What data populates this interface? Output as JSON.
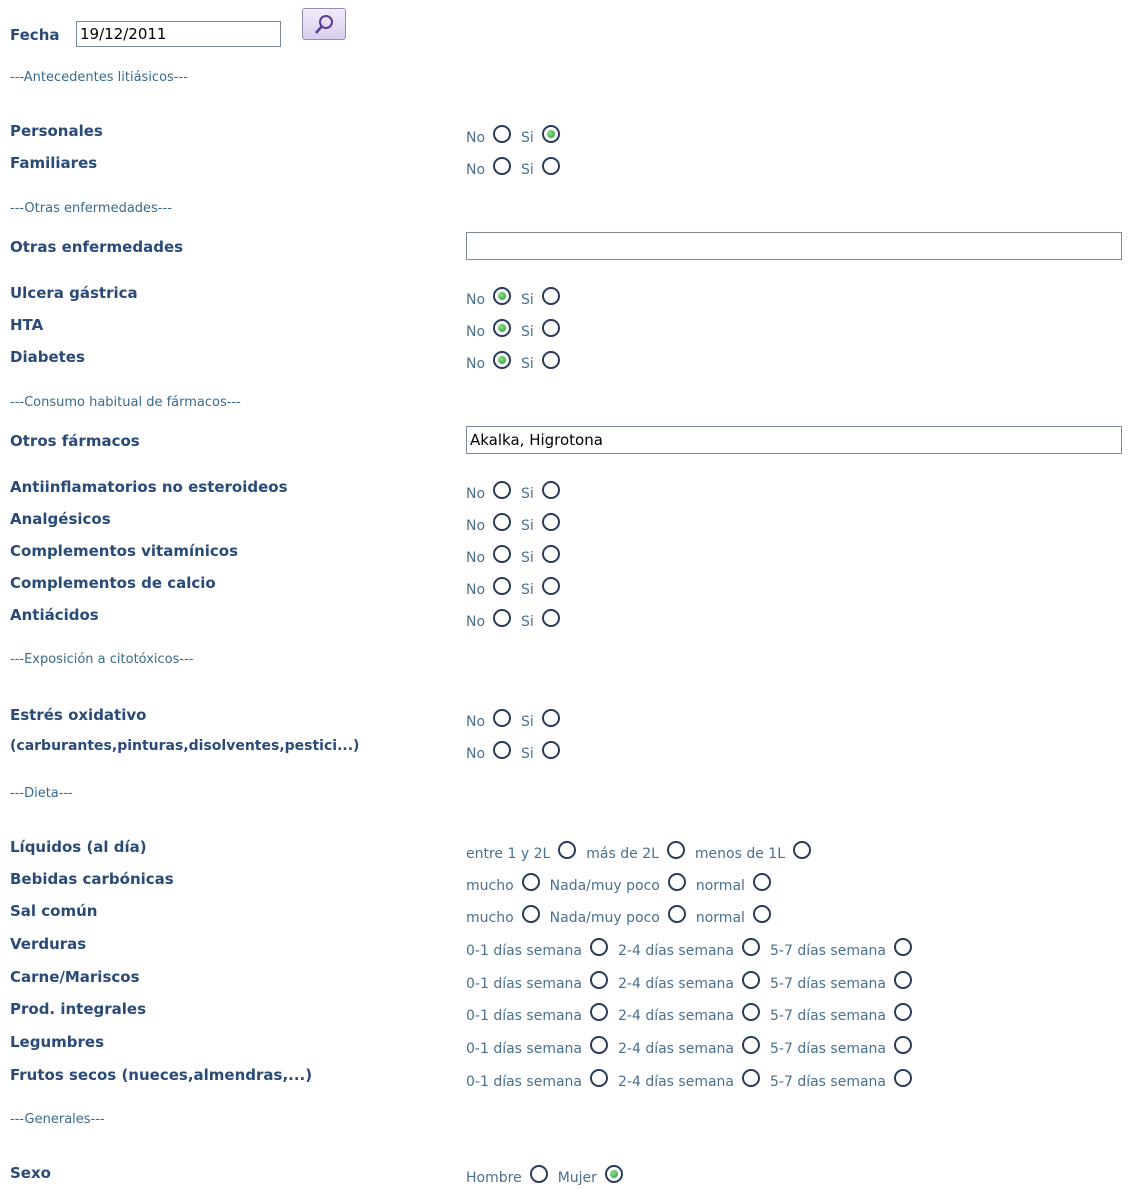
{
  "fecha": {
    "label": "Fecha",
    "value": "19/12/2011"
  },
  "sections": {
    "antecedentes": "---Antecedentes litiásicos---",
    "otras": "---Otras enfermedades---",
    "farmacos": "---Consumo habitual de fármacos---",
    "citotoxicos": "---Exposición a citotóxicos---",
    "dieta": "---Dieta---",
    "generales": "---Generales---"
  },
  "options": {
    "no": "No",
    "si": "Si",
    "entre": "entre 1 y 2L",
    "mas": "más de 2L",
    "menos": "menos de 1L",
    "mucho": "mucho",
    "nada": "Nada/muy poco",
    "normal": "normal",
    "d01": "0-1 días semana",
    "d24": "2-4 días semana",
    "d57": "5-7 días semana",
    "hombre": "Hombre",
    "mujer": "Mujer"
  },
  "personales": {
    "label": "Personales",
    "selected": "si"
  },
  "familiares": {
    "label": "Familiares",
    "selected": ""
  },
  "otras_enfermedades": {
    "label": "Otras enfermedades",
    "value": ""
  },
  "ulcera": {
    "label": "Ulcera gástrica",
    "selected": "no"
  },
  "hta": {
    "label": "HTA",
    "selected": "no"
  },
  "diabetes": {
    "label": "Diabetes",
    "selected": "no"
  },
  "otros_farmacos": {
    "label": "Otros fármacos",
    "value": "Akalka, Higrotona"
  },
  "antiinflamatorios": {
    "label": "Antiinflamatorios no esteroideos",
    "selected": ""
  },
  "analgesicos": {
    "label": "Analgésicos",
    "selected": ""
  },
  "vitaminicos": {
    "label": "Complementos vitamínicos",
    "selected": ""
  },
  "calcio": {
    "label": "Complementos de calcio",
    "selected": ""
  },
  "antiacidos": {
    "label": "Antiácidos",
    "selected": ""
  },
  "estres": {
    "label": "Estrés oxidativo",
    "selected": ""
  },
  "carburantes": {
    "label": "(carburantes,pinturas,disolventes,pestici...)",
    "selected": ""
  },
  "liquidos": {
    "label": "Líquidos (al día)",
    "selected": ""
  },
  "bebidas": {
    "label": "Bebidas carbónicas",
    "selected": ""
  },
  "sal": {
    "label": "Sal común",
    "selected": ""
  },
  "verduras": {
    "label": "Verduras",
    "selected": ""
  },
  "carne": {
    "label": "Carne/Mariscos",
    "selected": ""
  },
  "integrales": {
    "label": "Prod. integrales",
    "selected": ""
  },
  "legumbres": {
    "label": "Legumbres",
    "selected": ""
  },
  "frutos": {
    "label": "Frutos secos (nueces,almendras,...)",
    "selected": ""
  },
  "sexo": {
    "label": "Sexo",
    "selected": "mujer"
  },
  "icons": {
    "search_button": "magnifier-icon",
    "radio": "radio-icon"
  }
}
